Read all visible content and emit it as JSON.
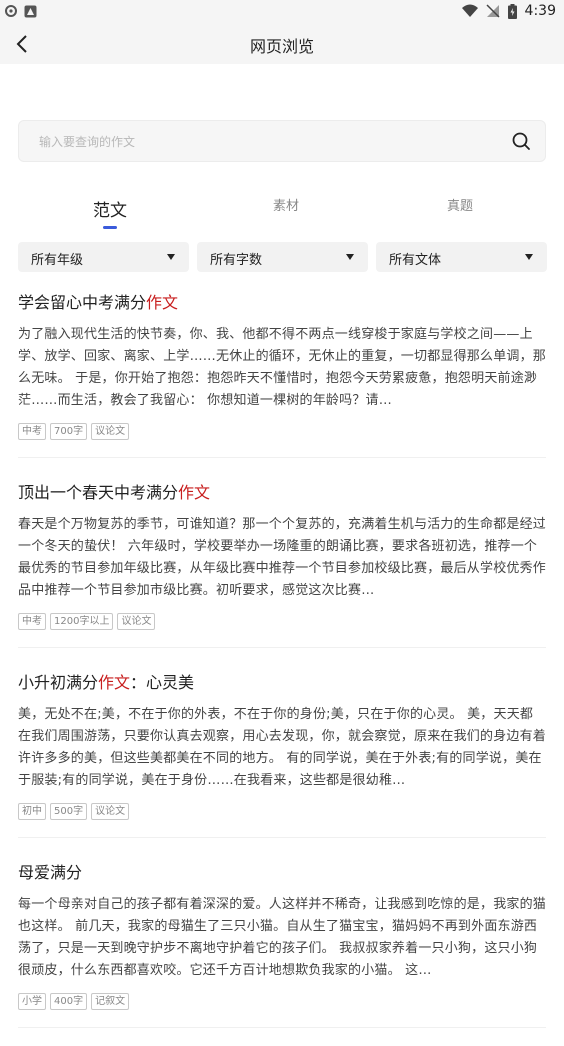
{
  "status_bar": {
    "time": "4:39"
  },
  "header": {
    "title": "网页浏览"
  },
  "search": {
    "placeholder": "输入要查询的作文"
  },
  "tabs": [
    {
      "label": "范文",
      "active": true
    },
    {
      "label": "素材",
      "active": false
    },
    {
      "label": "真题",
      "active": false
    }
  ],
  "filters": [
    {
      "label": "所有年级"
    },
    {
      "label": "所有字数"
    },
    {
      "label": "所有文体"
    }
  ],
  "articles": [
    {
      "title_main": "学会留心中考满分",
      "title_highlight": "作文",
      "title_tail": "",
      "excerpt": "为了融入现代生活的快节奏，你、我、他都不得不两点一线穿梭于家庭与学校之间——上学、放学、回家、离家、上学……无休止的循环，无休止的重复，一切都显得那么单调，那么无味。 于是，你开始了抱怨：抱怨昨天不懂惜时，抱怨今天劳累疲惫，抱怨明天前途渺茫……而生活，教会了我留心： 你想知道一棵树的年龄吗？请…",
      "tags": [
        "中考",
        "700字",
        "议论文"
      ]
    },
    {
      "title_main": "顶出一个春天中考满分",
      "title_highlight": "作文",
      "title_tail": "",
      "excerpt": "春天是个万物复苏的季节，可谁知道？那一个个复苏的，充满着生机与活力的生命都是经过一个冬天的蛰伏！ 六年级时，学校要举办一场隆重的朗诵比赛，要求各班初选，推荐一个最优秀的节目参加年级比赛，从年级比赛中推荐一个节目参加校级比赛，最后从学校优秀作品中推荐一个节目参加市级比赛。初听要求，感觉这次比赛…",
      "tags": [
        "中考",
        "1200字以上",
        "议论文"
      ]
    },
    {
      "title_main": "小升初满分",
      "title_highlight": "作文",
      "title_tail": "：心灵美",
      "excerpt": "美，无处不在;美，不在于你的外表，不在于你的身份;美，只在于你的心灵。 美，天天都在我们周围游荡，只要你认真去观察，用心去发现，你，就会察觉，原来在我们的身边有着许许多多的美，但这些美都美在不同的地方。 有的同学说，美在于外表;有的同学说，美在于服装;有的同学说，美在于身份……在我看来，这些都是很幼稚…",
      "tags": [
        "初中",
        "500字",
        "议论文"
      ]
    },
    {
      "title_main": "母爱满分",
      "title_highlight": "",
      "title_tail": "",
      "excerpt": "每一个母亲对自己的孩子都有着深深的爱。人这样并不稀奇，让我感到吃惊的是，我家的猫也这样。 前几天，我家的母猫生了三只小猫。自从生了猫宝宝，猫妈妈不再到外面东游西荡了，只是一天到晚守护步不离地守护着它的孩子们。 我叔叔家养着一只小狗，这只小狗很顽皮，什么东西都喜欢咬。它还千方百计地想欺负我家的小猫。 这…",
      "tags": [
        "小学",
        "400字",
        "记叙文"
      ]
    }
  ],
  "colors": {
    "accent": "#3b5bdb",
    "highlight": "#c81e1e"
  }
}
